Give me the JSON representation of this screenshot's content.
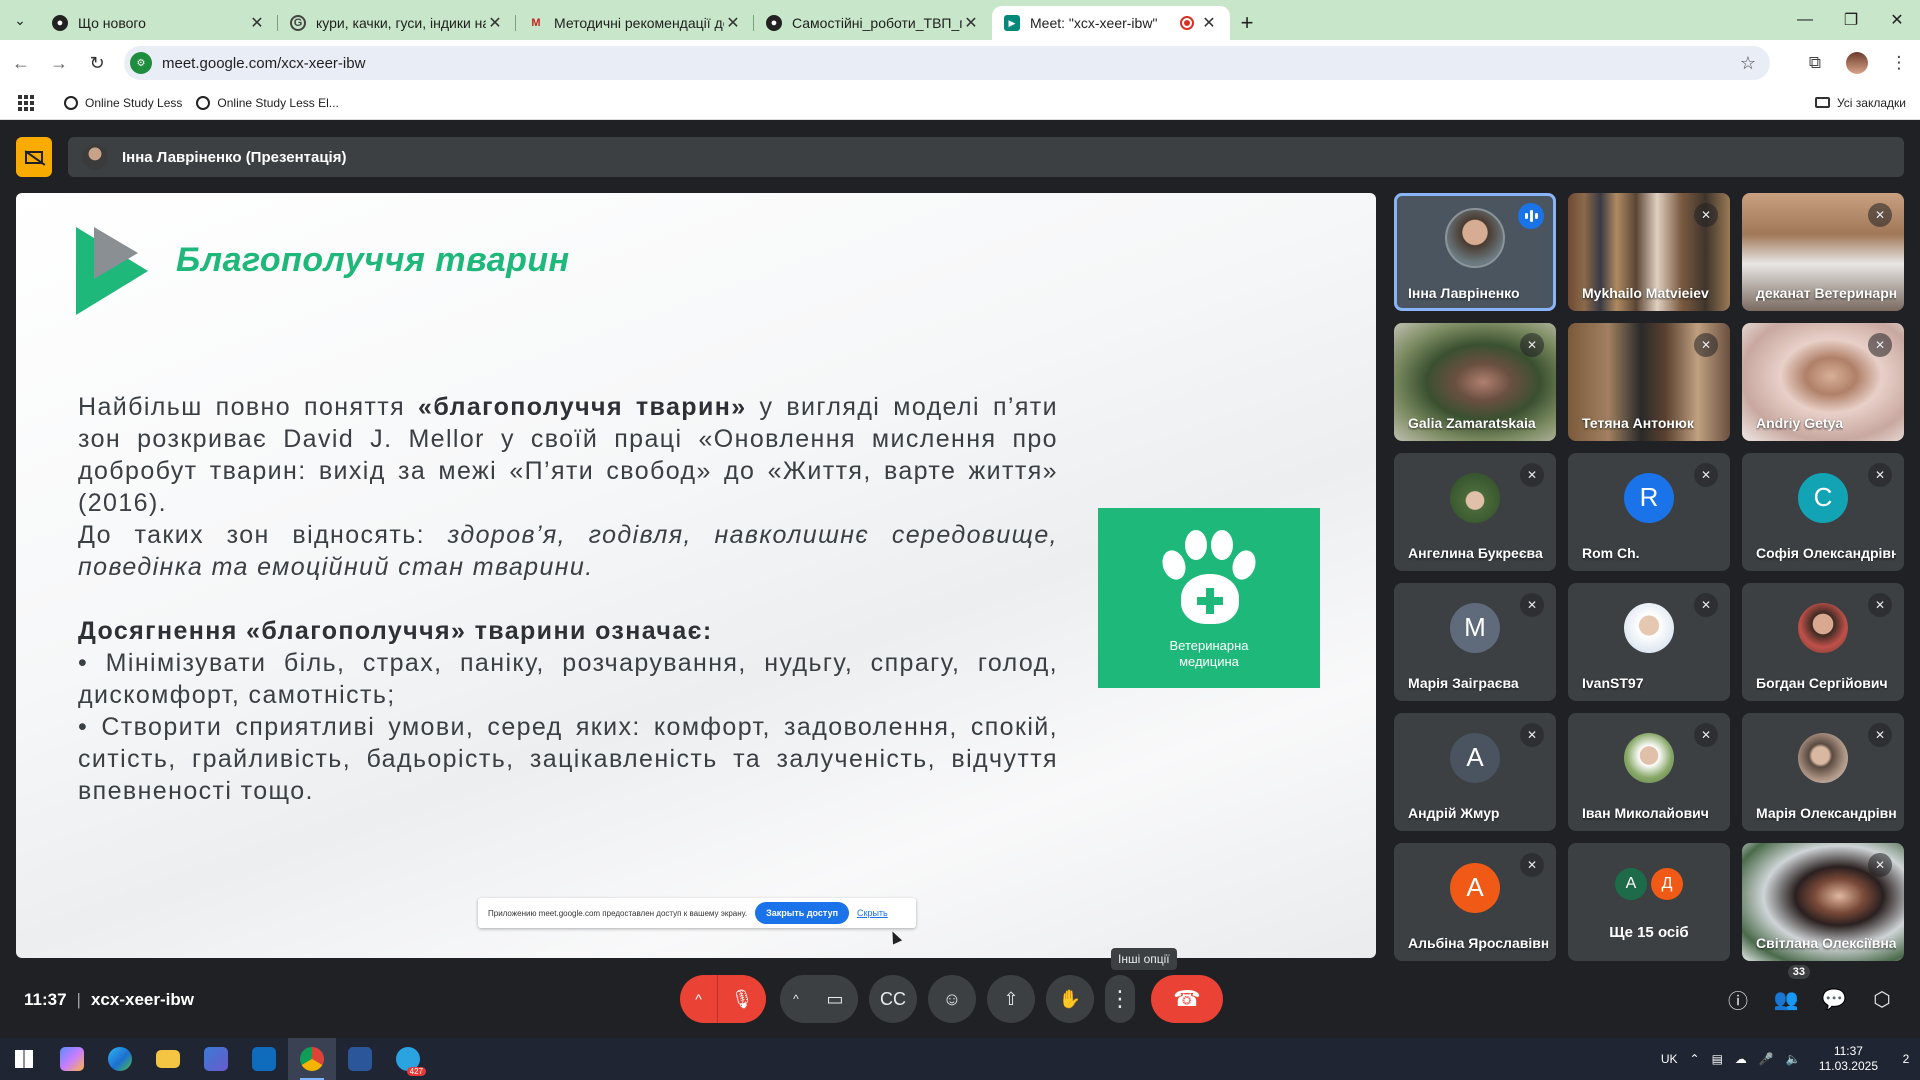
{
  "browser": {
    "tabs": [
      {
        "title": "Що нового",
        "favicon": "github-icon",
        "active": false
      },
      {
        "title": "кури, качки, гуси, індики на біо",
        "favicon": "google-icon",
        "active": false
      },
      {
        "title": "Методичні рекомендації до ві",
        "favicon": "gmail-icon",
        "active": false
      },
      {
        "title": "Самостійні_роботи_ТВП_птахів",
        "favicon": "github-icon",
        "active": false
      },
      {
        "title": "Meet: \"xcx-xeer-ibw\"",
        "favicon": "meet-icon",
        "active": true
      }
    ],
    "url": "meet.google.com/xcx-xeer-ibw",
    "bookmarks": [
      "Online Study Less",
      "Online Study Less El..."
    ],
    "all_bookmarks": "Усі закладки"
  },
  "meet": {
    "presenter_label": "Інна Лавріненко (Презентація)",
    "slide": {
      "title": "Благополуччя тварин",
      "p1_pre": "Найбільш повно поняття ",
      "p1_bold": "«благополуччя тварин»",
      "p1_post": " у вигляді моделі п’яти зон розкриває David J. Mellor у своїй праці «Оновлення мислення про добробут тварин: вихід за межі «П’яти свобод» до «Життя, варте життя» (2016).",
      "p2_pre": "До таких зон відносять: ",
      "p2_italic": "здоров’я, годівля, навколишнє середовище, поведінка та емоційний стан тварини.",
      "heading2": "Досягнення «благополуччя» тварини означає:",
      "bullet1": "• Мінімізувати біль, страх, паніку, розчарування, нудьгу, спрагу, голод, дискомфорт, самотність;",
      "bullet2": "• Створити сприятливі умови, серед яких: комфорт, задоволення, спокій, ситість, грайливість, бадьорість, зацікавленість та залученість, відчуття впевненості тощо.",
      "card_label_line1": "Ветеринарна",
      "card_label_line2": "медицина",
      "share_notice": "Приложению meet.google.com предоставлен доступ к вашему экрану.",
      "share_stop": "Закрыть доступ",
      "share_hide": "Скрыть"
    },
    "participants": [
      {
        "name": "Інна Лавріненко",
        "kind": "photo",
        "speaking": true
      },
      {
        "name": "Mykhailo Matvieiev",
        "kind": "camera",
        "muted": true
      },
      {
        "name": "деканат Ветеринарної медицини",
        "kind": "camera",
        "muted": true
      },
      {
        "name": "Galia Zamaratskaia",
        "kind": "camera",
        "muted": true
      },
      {
        "name": "Тетяна Антонюк",
        "kind": "camera",
        "muted": true
      },
      {
        "name": "Andriy Getya",
        "kind": "camera",
        "muted": true
      },
      {
        "name": "Ангелина Букреєва",
        "kind": "photo",
        "muted": true
      },
      {
        "name": "Rom Ch.",
        "kind": "letter",
        "letter": "R",
        "color": "#1a73e8",
        "muted": true
      },
      {
        "name": "Софія Олександрівна",
        "kind": "letter",
        "letter": "C",
        "color": "#12a4b5",
        "muted": true
      },
      {
        "name": "Марія Заіграєва",
        "kind": "letter",
        "letter": "M",
        "color": "#5f6b7a",
        "muted": true
      },
      {
        "name": "IvanST97",
        "kind": "photo",
        "muted": true
      },
      {
        "name": "Богдан Сергійович",
        "kind": "photo",
        "muted": true
      },
      {
        "name": "Андрій Жмур",
        "kind": "letter",
        "letter": "A",
        "color": "#4a5360",
        "muted": true
      },
      {
        "name": "Іван Миколайович",
        "kind": "photo",
        "muted": true
      },
      {
        "name": "Марія Олександрівна",
        "kind": "photo",
        "muted": true
      },
      {
        "name": "Альбіна Ярославівна",
        "kind": "letter",
        "letter": "A",
        "color": "#f05a16",
        "muted": true
      },
      {
        "name": "Ще 15 осіб",
        "kind": "more",
        "letters": [
          "A",
          "Д"
        ]
      },
      {
        "name": "Світлана Олексіївна",
        "kind": "camera",
        "muted": true
      }
    ],
    "time": "11:37",
    "meeting_code": "xcx-xeer-ibw",
    "tooltip": "Інші опції",
    "people_count": "33"
  },
  "taskbar": {
    "language": "UK",
    "time": "11:37",
    "date": "11.03.2025",
    "telegram_badge": "427",
    "notifications": "2"
  }
}
